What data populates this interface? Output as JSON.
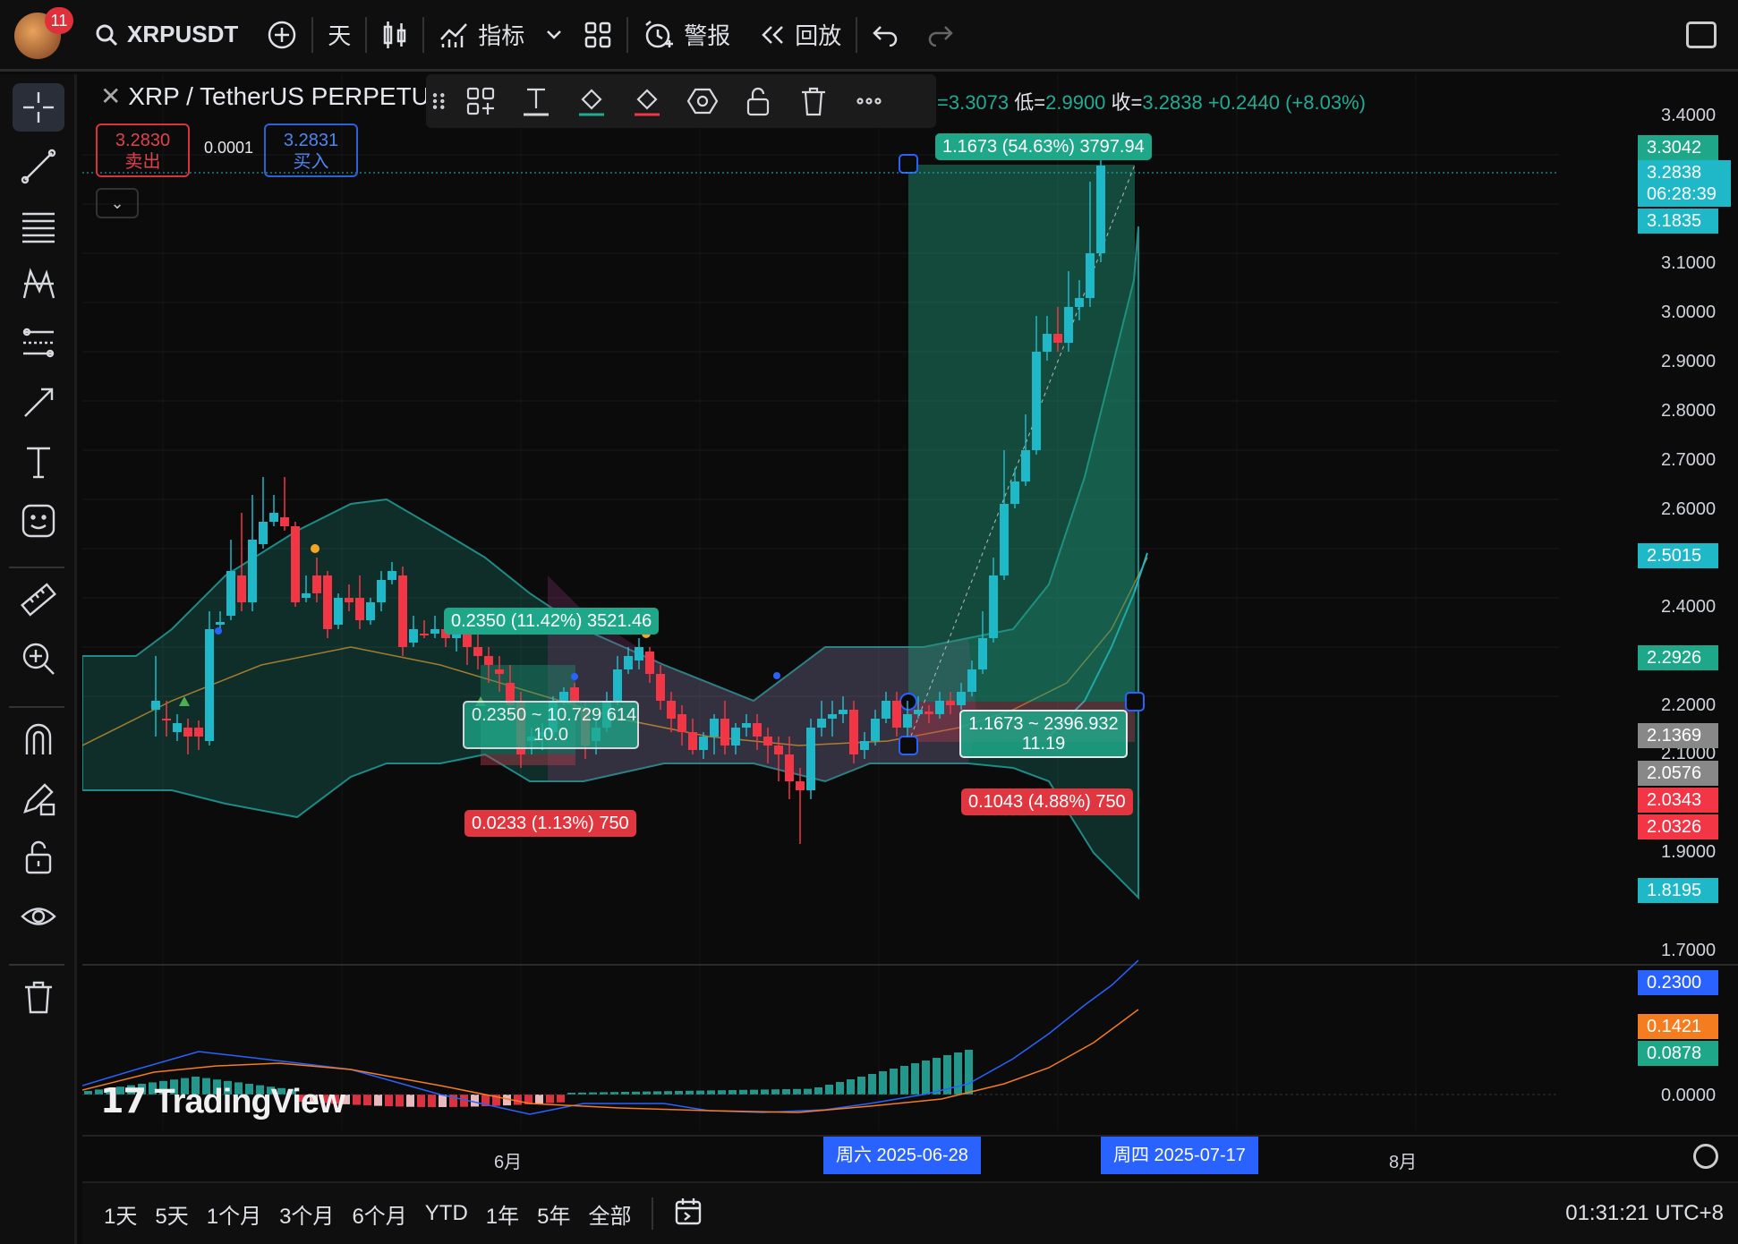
{
  "topbar": {
    "notification_count": "11",
    "symbol": "XRPUSDT",
    "interval": "天",
    "indicators_label": "指标",
    "alerts_label": "警报",
    "replay_label": "回放"
  },
  "legend": {
    "title": "XRP / TetherUS PERPETUA",
    "ohlc_prefix": "=3.3073",
    "low_label": "低=",
    "low_value": "2.9900",
    "close_label": "收=",
    "close_value": "3.2838",
    "change": "+0.2440 (+8.03%)"
  },
  "order": {
    "sell_price": "3.2830",
    "sell_label": "卖出",
    "spread": "0.0001",
    "buy_price": "3.2831",
    "buy_label": "买入"
  },
  "labels": {
    "long_top": "1.1673 (54.63%) 3797.94",
    "long_mid_line1": "1.1673 ~ 2396.932",
    "long_mid_line2": "11.19",
    "long_bottom": "0.1043 (4.88%) 750",
    "short_top": "0.2350 (11.42%) 3521.46",
    "short_mid_line1": "0.2350 ~ 10.729 614",
    "short_mid_line2": "10.0",
    "short_bottom": "0.0233 (1.13%) 750"
  },
  "price_axis": {
    "ticks": [
      "3.4000",
      "3.1000",
      "3.0000",
      "2.9000",
      "2.8000",
      "2.7000",
      "2.6000",
      "2.4000",
      "2.2000",
      "2.1000",
      "1.9000",
      "1.7000"
    ],
    "tags": {
      "t1": "3.3042",
      "t2_price": "3.2838",
      "t2_countdown": "06:28:39",
      "t3": "3.1835",
      "t4": "2.5015",
      "t5": "2.2926",
      "t6": "2.1369",
      "t7": "2.0576",
      "t8": "2.0343",
      "t9": "2.0326",
      "t10": "1.8195"
    },
    "macd_tags": {
      "m1": "0.2300",
      "m2": "0.1421",
      "m3": "0.0878",
      "m4": "0.0000"
    }
  },
  "time_axis": {
    "jun": "6月",
    "aug": "8月",
    "mark1": "周六 2025-06-28",
    "mark2": "周四 2025-07-17"
  },
  "bottom": {
    "ranges": [
      "1天",
      "5天",
      "1个月",
      "3个月",
      "6个月",
      "YTD",
      "1年",
      "5年",
      "全部"
    ],
    "clock": "01:31:21 UTC+8"
  },
  "watermark": "TradingView",
  "colors": {
    "up": "#22ab94",
    "down": "#f23645",
    "cyan": "#1fb8c9",
    "tag_blue": "#2962ff"
  }
}
